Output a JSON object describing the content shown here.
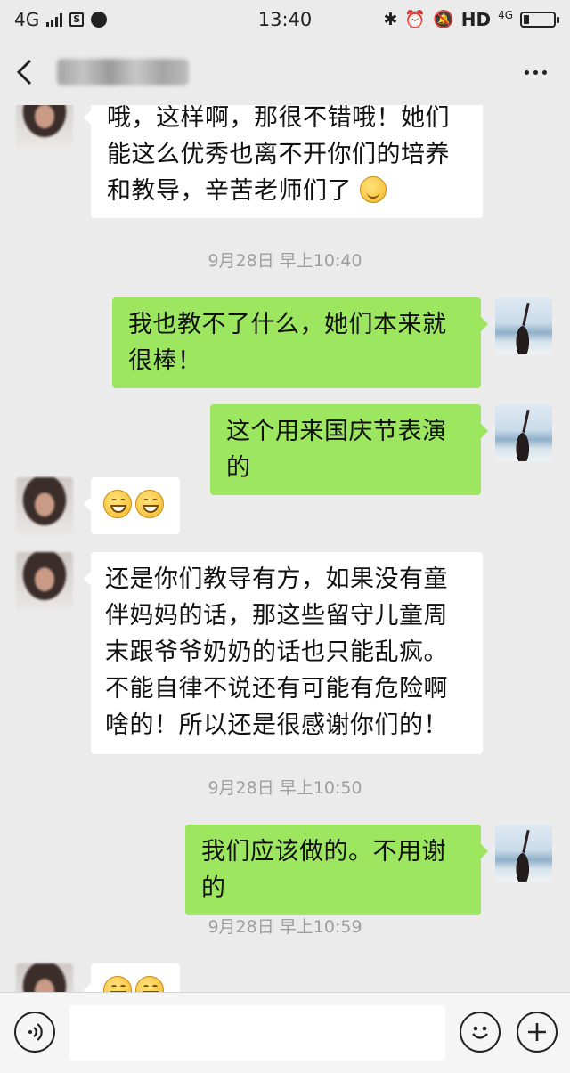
{
  "status_bar": {
    "network": "4G",
    "time": "13:40",
    "hd": "HD",
    "network_right": "4G",
    "battery_level": 0.2
  },
  "title_bar": {
    "back_icon": "chevron-left-icon",
    "contact_name": "",
    "more_icon": "more-dots-icon"
  },
  "messages": [
    {
      "side": "in",
      "text": "哦，这样啊，那很不错哦！她们能这么优秀也离不开你们的培养和教导，辛苦老师们了",
      "emoji": "smiling-face"
    },
    {
      "type": "timestamp",
      "text": "9月28日 早上10:40"
    },
    {
      "side": "out",
      "text": "我也教不了什么，她们本来就很棒！"
    },
    {
      "side": "out",
      "text": "这个用来国庆节表演的"
    },
    {
      "side": "in",
      "text": "",
      "emoji": "grinning-face x2"
    },
    {
      "side": "in",
      "text": "还是你们教导有方，如果没有童伴妈妈的话，那这些留守儿童周末跟爷爷奶奶的话也只能乱疯。不能自律不说还有可能有危险啊啥的！所以还是很感谢你们的！"
    },
    {
      "type": "timestamp",
      "text": "9月28日 早上10:50"
    },
    {
      "side": "out",
      "text": "我们应该做的。不用谢的"
    },
    {
      "type": "timestamp",
      "text": "9月28日 早上10:59"
    },
    {
      "side": "in",
      "text": "",
      "emoji": "grinning-face x2"
    }
  ],
  "input_bar": {
    "voice_icon": "voice-icon",
    "input_value": "",
    "emoji_icon": "emoji-icon",
    "plus_icon": "plus-icon"
  },
  "colors": {
    "background": "#ebebeb",
    "incoming_bubble": "#ffffff",
    "outgoing_bubble": "#9de760",
    "timestamp": "#9e9e9e"
  }
}
